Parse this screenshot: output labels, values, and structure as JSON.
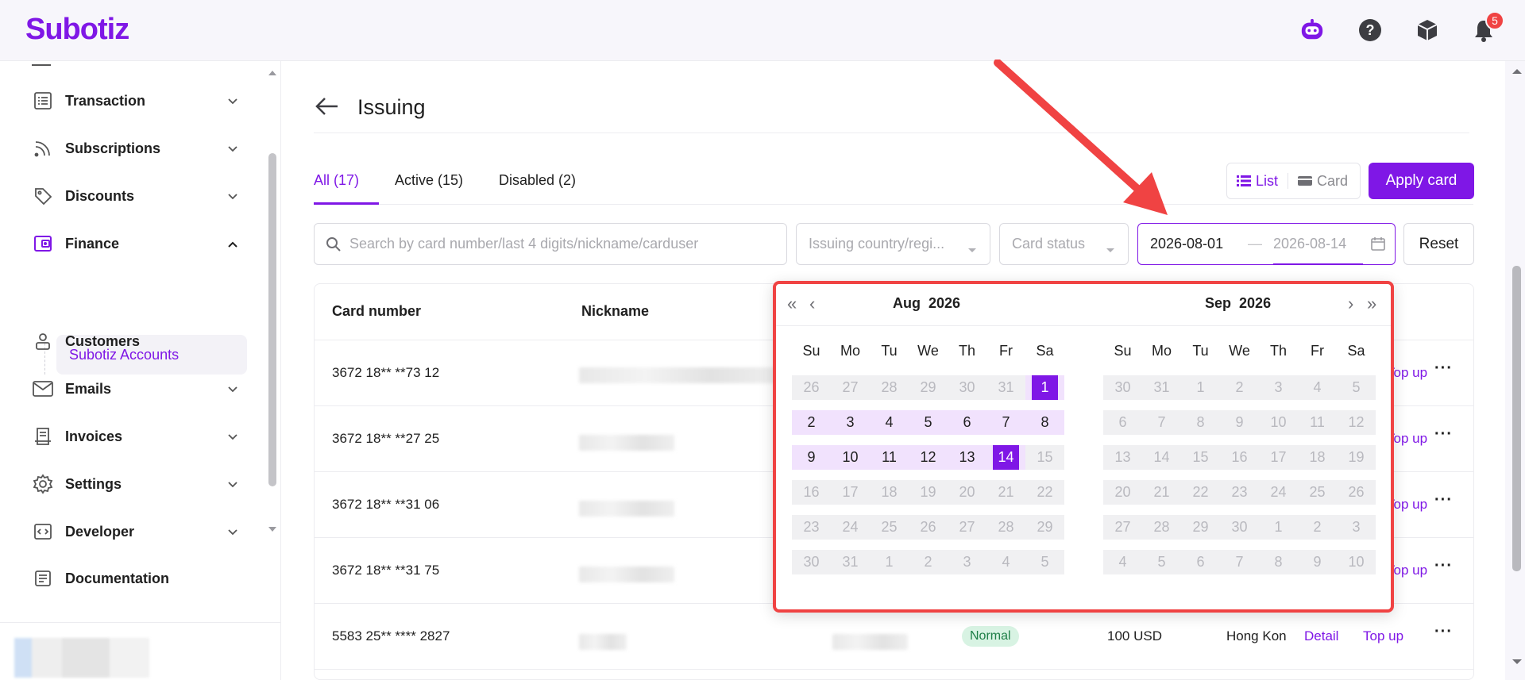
{
  "app": {
    "logo": "Subotiz",
    "notification_count": "5"
  },
  "sidebar": {
    "items": [
      {
        "label": "Transaction",
        "icon": "list-icon",
        "expandable": true
      },
      {
        "label": "Subscriptions",
        "icon": "rss-icon",
        "expandable": true
      },
      {
        "label": "Discounts",
        "icon": "tag-icon",
        "expandable": true
      },
      {
        "label": "Finance",
        "icon": "wallet-icon",
        "expandable": true,
        "expanded": true
      },
      {
        "label": "Customers",
        "icon": "person-icon",
        "expandable": false
      },
      {
        "label": "Emails",
        "icon": "mail-icon",
        "expandable": true
      },
      {
        "label": "Invoices",
        "icon": "invoice-icon",
        "expandable": true
      },
      {
        "label": "Settings",
        "icon": "gear-icon",
        "expandable": true
      },
      {
        "label": "Developer",
        "icon": "code-icon",
        "expandable": true
      },
      {
        "label": "Documentation",
        "icon": "doc-icon",
        "expandable": false
      }
    ],
    "finance_sub": "Subotiz Accounts"
  },
  "page": {
    "title": "Issuing"
  },
  "tabs": [
    {
      "label": "All  (17)",
      "active": true
    },
    {
      "label": "Active  (15)",
      "active": false
    },
    {
      "label": "Disabled  (2)",
      "active": false
    }
  ],
  "view_toggle": {
    "list": "List",
    "card": "Card"
  },
  "apply_button": "Apply card",
  "filters": {
    "search_placeholder": "Search by card number/last 4 digits/nickname/carduser",
    "country_placeholder": "Issuing country/regi...",
    "status_placeholder": "Card status",
    "date_start": "2026-08-01",
    "date_sep": "—",
    "date_end": "2026-08-14",
    "reset": "Reset"
  },
  "table": {
    "headers": {
      "card_number": "Card number",
      "nickname": "Nickname"
    },
    "rows": [
      {
        "card": "3672 18** **73 12",
        "action": "Top up"
      },
      {
        "card": "3672 18** **27 25",
        "action": "Top up"
      },
      {
        "card": "3672 18** **31 06",
        "action": "Top up"
      },
      {
        "card": "3672 18** **31 75",
        "action": "Top up"
      },
      {
        "card": "5583 25** **** 2827",
        "status": "Normal",
        "balance": "100 USD",
        "country": "Hong Kon",
        "detail": "Detail",
        "action": "Top up"
      }
    ]
  },
  "calendar": {
    "weekdays": [
      "Su",
      "Mo",
      "Tu",
      "We",
      "Th",
      "Fr",
      "Sa"
    ],
    "left": {
      "month": "Aug",
      "year": "2026",
      "days": [
        "26",
        "27",
        "28",
        "29",
        "30",
        "31",
        "1",
        "2",
        "3",
        "4",
        "5",
        "6",
        "7",
        "8",
        "9",
        "10",
        "11",
        "12",
        "13",
        "14",
        "15",
        "16",
        "17",
        "18",
        "19",
        "20",
        "21",
        "22",
        "23",
        "24",
        "25",
        "26",
        "27",
        "28",
        "29",
        "30",
        "31",
        "1",
        "2",
        "3",
        "4",
        "5"
      ],
      "state": [
        "o",
        "o",
        "o",
        "o",
        "o",
        "o",
        "s",
        "r",
        "r",
        "r",
        "r",
        "r",
        "r",
        "r",
        "r",
        "r",
        "r",
        "r",
        "r",
        "s",
        "o",
        "o",
        "o",
        "o",
        "o",
        "o",
        "o",
        "o",
        "o",
        "o",
        "o",
        "o",
        "o",
        "o",
        "o",
        "o",
        "o",
        "o",
        "o",
        "o",
        "o",
        "o"
      ]
    },
    "right": {
      "month": "Sep",
      "year": "2026",
      "days": [
        "30",
        "31",
        "1",
        "2",
        "3",
        "4",
        "5",
        "6",
        "7",
        "8",
        "9",
        "10",
        "11",
        "12",
        "13",
        "14",
        "15",
        "16",
        "17",
        "18",
        "19",
        "20",
        "21",
        "22",
        "23",
        "24",
        "25",
        "26",
        "27",
        "28",
        "29",
        "30",
        "1",
        "2",
        "3",
        "4",
        "5",
        "6",
        "7",
        "8",
        "9",
        "10"
      ]
    }
  },
  "colors": {
    "brand": "#7f17e6",
    "annotation": "#f04343"
  }
}
